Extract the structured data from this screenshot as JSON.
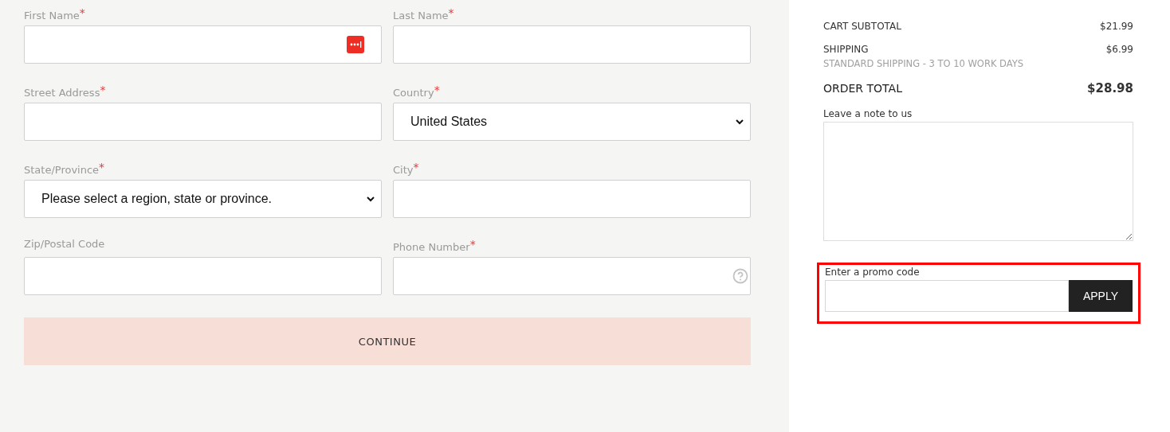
{
  "form": {
    "fields": [
      {
        "label": "First Name",
        "required": true,
        "kind": "autofill"
      },
      {
        "label": "Last Name",
        "required": true,
        "kind": "text"
      },
      {
        "label": "Street Address",
        "required": true,
        "kind": "text"
      },
      {
        "label": "Country",
        "required": true,
        "kind": "select",
        "value": "United States"
      },
      {
        "label": "State/Province",
        "required": true,
        "kind": "select",
        "value": "Please select a region, state or province."
      },
      {
        "label": "City",
        "required": true,
        "kind": "text"
      },
      {
        "label": "Zip/Postal Code",
        "required": false,
        "kind": "text"
      },
      {
        "label": "Phone Number",
        "required": true,
        "kind": "help"
      }
    ],
    "required_mark": "*",
    "continue_button": "CONTINUE"
  },
  "summary": {
    "rows": [
      {
        "label": "CART SUBTOTAL",
        "value": "$21.99",
        "kind": "normal"
      },
      {
        "label": "SHIPPING",
        "value": "$6.99",
        "note": "STANDARD SHIPPING - 3 TO 10 WORK DAYS",
        "kind": "normal"
      },
      {
        "label": "ORDER TOTAL",
        "value": "$28.98",
        "kind": "total"
      }
    ],
    "note_label": "Leave a note to us",
    "promo": {
      "label": "Enter a promo code",
      "button": "APPLY",
      "highlighted": true
    }
  }
}
